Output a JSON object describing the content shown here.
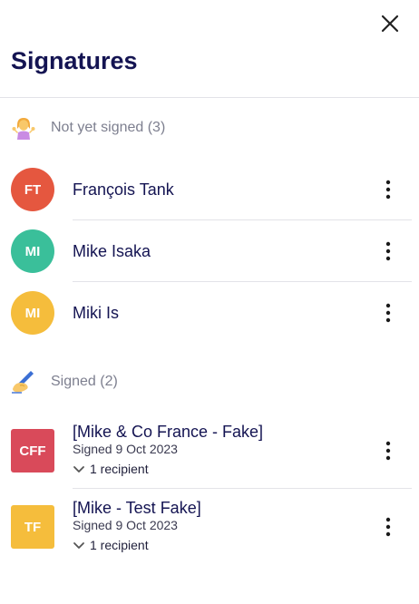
{
  "header": {
    "title": "Signatures"
  },
  "colors": {
    "title": "#141452",
    "avatar_red": "#e5573f",
    "avatar_green": "#3abf9a",
    "avatar_yellow": "#f5bd3c",
    "doc_red": "#d94a5a",
    "doc_yellow": "#f5bd3c"
  },
  "not_signed": {
    "icon": "person-shrugging-icon",
    "label": "Not yet signed (3)",
    "people": [
      {
        "initials": "FT",
        "name": "François Tank",
        "color": "#e5573f"
      },
      {
        "initials": "MI",
        "name": "Mike Isaka",
        "color": "#3abf9a"
      },
      {
        "initials": "MI",
        "name": "Miki Is",
        "color": "#f5bd3c"
      }
    ]
  },
  "signed": {
    "icon": "writing-hand-icon",
    "label": "Signed (2)",
    "documents": [
      {
        "initials": "CFF",
        "title": "[Mike & Co France - Fake]",
        "date": "Signed 9 Oct 2023",
        "recipients": "1 recipient",
        "color": "#d94a5a"
      },
      {
        "initials": "TF",
        "title": "[Mike - Test Fake]",
        "date": "Signed 9 Oct 2023",
        "recipients": "1 recipient",
        "color": "#f5bd3c"
      }
    ]
  }
}
